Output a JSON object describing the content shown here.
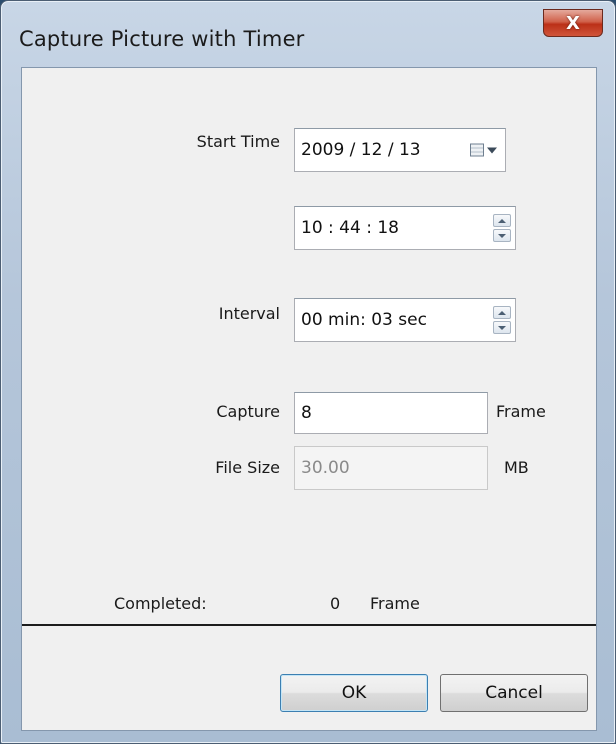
{
  "window": {
    "title": "Capture Picture with Timer",
    "close_label": "X"
  },
  "form": {
    "start_time_label": "Start Time",
    "start_date_value": "2009 / 12 / 13",
    "start_time_value": "10 : 44 : 18",
    "interval_label": "Interval",
    "interval_value": "00 min: 03 sec",
    "capture_label": "Capture",
    "capture_value": "8",
    "capture_unit": "Frame",
    "file_size_label": "File Size",
    "file_size_value": "30.00",
    "file_size_unit": "MB"
  },
  "status": {
    "completed_label": "Completed:",
    "completed_count": "0",
    "completed_unit": "Frame"
  },
  "buttons": {
    "ok_label": "OK",
    "cancel_label": "Cancel"
  },
  "icons": {
    "close": "close-icon",
    "calendar": "calendar-icon",
    "dropdown": "chevron-down-icon",
    "spin_up": "spin-up-icon",
    "spin_down": "spin-down-icon"
  },
  "colors": {
    "close_button": "#c8442c",
    "default_button_border": "#3c7fb1",
    "client_background": "#f0f0f0"
  }
}
